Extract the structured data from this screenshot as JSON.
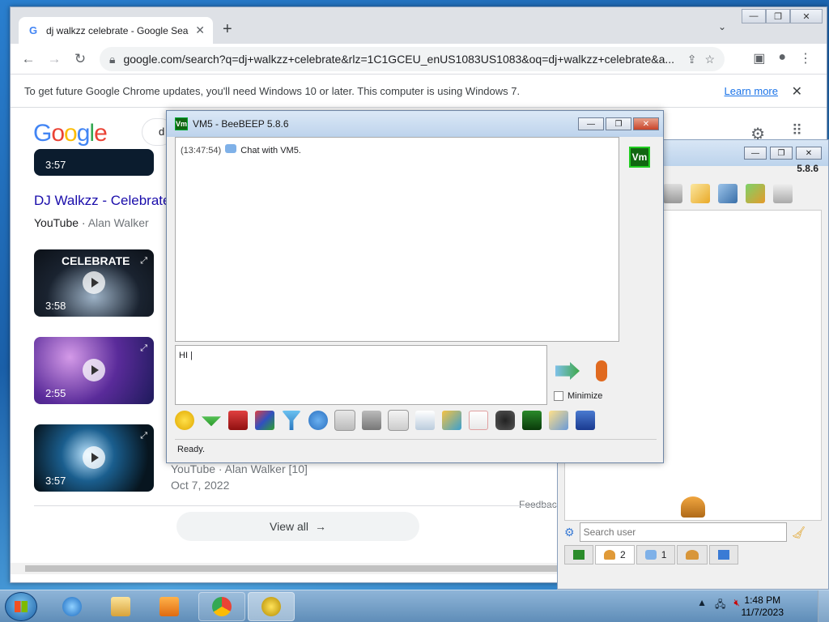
{
  "chrome": {
    "tab_title": "dj walkzz celebrate - Google Search",
    "new_tab": "+",
    "url": "google.com/search?q=dj+walkzz+celebrate&rlz=1C1GCEU_enUS1083US1083&oq=dj+walkzz+celebrate&a...",
    "infobar_text": "To get future Google Chrome updates, you'll need Windows 10 or later. This computer is using Windows 7.",
    "infobar_link": "Learn more",
    "window_controls": [
      "—",
      "❐",
      "✕"
    ]
  },
  "google": {
    "logo": "Google",
    "search_partial": "d",
    "videos": [
      {
        "duration": "3:57"
      },
      {
        "duration": "3:58",
        "thumb_text": "CELEBRATE"
      },
      {
        "duration": "2:55"
      },
      {
        "duration": "3:57"
      }
    ],
    "result_title": "DJ Walkzz - Celebrate",
    "result_source": "YouTube",
    "result_author": "Alan Walker",
    "result_partial_meta": "YouTube · Alan Walker [10]",
    "result_date": "Oct 7, 2022",
    "feedback": "Feedbac",
    "view_all": "View all"
  },
  "beebeep_chat": {
    "title": "VM5 - BeeBEEP 5.8.6",
    "vm_badge": "Vm",
    "history_time": "(13:47:54)",
    "history_text": "Chat with VM5.",
    "input_text": "HI |",
    "minimize_label": "Minimize",
    "status": "Ready."
  },
  "beebeep_main": {
    "version": "5.8.6",
    "search_placeholder": "Search user",
    "tab_users_count": "2",
    "tab_chats_count": "1"
  },
  "taskbar": {
    "time": "1:48 PM",
    "date": "11/7/2023"
  }
}
